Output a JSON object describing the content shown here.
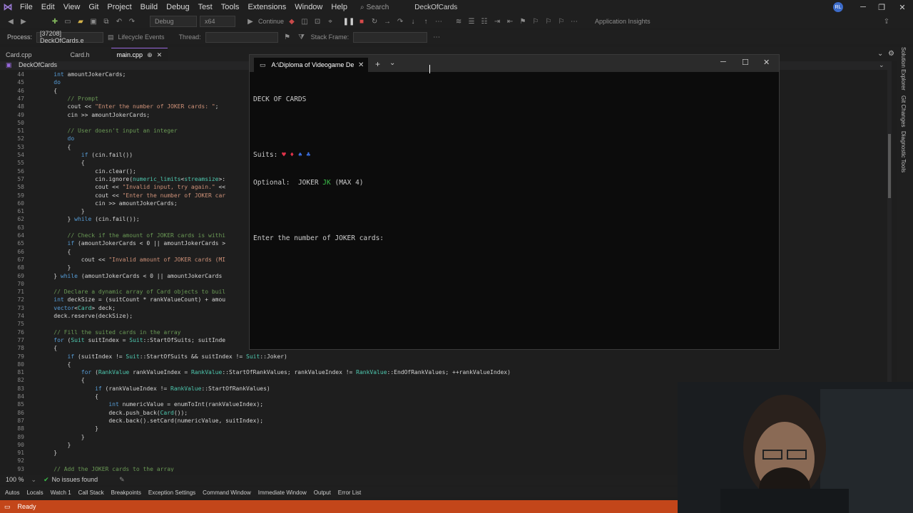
{
  "menu": {
    "items": [
      "File",
      "Edit",
      "View",
      "Git",
      "Project",
      "Build",
      "Debug",
      "Test",
      "Tools",
      "Extensions",
      "Window",
      "Help"
    ],
    "search_label": "Search",
    "solution_name": "DeckOfCards",
    "avatar_initials": "RL"
  },
  "toolbar": {
    "config": "Debug",
    "platform": "x64",
    "continue_label": "Continue",
    "insights_label": "Application Insights"
  },
  "process_bar": {
    "process_label": "Process:",
    "process_value": "[37208] DeckOfCards.e",
    "lifecycle_label": "Lifecycle Events",
    "thread_label": "Thread:",
    "stack_label": "Stack Frame:"
  },
  "doc_tabs": [
    {
      "label": "Card.cpp",
      "active": false
    },
    {
      "label": "Card.h",
      "active": false
    },
    {
      "label": "main.cpp",
      "active": true
    }
  ],
  "editor": {
    "project_scope": "DeckOfCards",
    "lines": [
      {
        "n": "44",
        "t": "    int amountJokerCards;"
      },
      {
        "n": "45",
        "t": "    do"
      },
      {
        "n": "46",
        "t": "    {"
      },
      {
        "n": "47",
        "t": "        // Prompt"
      },
      {
        "n": "48",
        "t": "        cout << \"Enter the number of JOKER cards: \";"
      },
      {
        "n": "49",
        "t": "        cin >> amountJokerCards;"
      },
      {
        "n": "50",
        "t": ""
      },
      {
        "n": "51",
        "t": "        // User doesn't input an integer"
      },
      {
        "n": "52",
        "t": "        do"
      },
      {
        "n": "53",
        "t": "        {"
      },
      {
        "n": "54",
        "t": "            if (cin.fail())"
      },
      {
        "n": "55",
        "t": "            {"
      },
      {
        "n": "56",
        "t": "                cin.clear();"
      },
      {
        "n": "57",
        "t": "                cin.ignore(numeric_limits<streamsize>:"
      },
      {
        "n": "58",
        "t": "                cout << \"Invalid input, try again.\" <<"
      },
      {
        "n": "59",
        "t": "                cout << \"Enter the number of JOKER car"
      },
      {
        "n": "60",
        "t": "                cin >> amountJokerCards;"
      },
      {
        "n": "61",
        "t": "            }"
      },
      {
        "n": "62",
        "t": "        } while (cin.fail());"
      },
      {
        "n": "63",
        "t": ""
      },
      {
        "n": "64",
        "t": "        // Check if the amount of JOKER cards is withi"
      },
      {
        "n": "65",
        "t": "        if (amountJokerCards < 0 || amountJokerCards >"
      },
      {
        "n": "66",
        "t": "        {"
      },
      {
        "n": "67",
        "t": "            cout << \"Invalid amount of JOKER cards (MI"
      },
      {
        "n": "68",
        "t": "        }"
      },
      {
        "n": "69",
        "t": "    } while (amountJokerCards < 0 || amountJokerCards"
      },
      {
        "n": "70",
        "t": ""
      },
      {
        "n": "71",
        "t": "    // Declare a dynamic array of Card objects to buil"
      },
      {
        "n": "72",
        "t": "    int deckSize = (suitCount * rankValueCount) + amou"
      },
      {
        "n": "73",
        "t": "    vector<Card> deck;"
      },
      {
        "n": "74",
        "t": "    deck.reserve(deckSize);"
      },
      {
        "n": "75",
        "t": ""
      },
      {
        "n": "76",
        "t": "    // Fill the suited cards in the array"
      },
      {
        "n": "77",
        "t": "    for (Suit suitIndex = Suit::StartOfSuits; suitInde"
      },
      {
        "n": "78",
        "t": "    {"
      },
      {
        "n": "79",
        "t": "        if (suitIndex != Suit::StartOfSuits && suitIndex != Suit::Joker)"
      },
      {
        "n": "80",
        "t": "        {"
      },
      {
        "n": "81",
        "t": "            for (RankValue rankValueIndex = RankValue::StartOfRankValues; rankValueIndex != RankValue::EndOfRankValues; ++rankValueIndex)"
      },
      {
        "n": "82",
        "t": "            {"
      },
      {
        "n": "83",
        "t": "                if (rankValueIndex != RankValue::StartOfRankValues)"
      },
      {
        "n": "84",
        "t": "                {"
      },
      {
        "n": "85",
        "t": "                    int numericValue = enumToInt(rankValueIndex);"
      },
      {
        "n": "86",
        "t": "                    deck.push_back(Card());"
      },
      {
        "n": "87",
        "t": "                    deck.back().setCard(numericValue, suitIndex);"
      },
      {
        "n": "88",
        "t": "                }"
      },
      {
        "n": "89",
        "t": "            }"
      },
      {
        "n": "90",
        "t": "        }"
      },
      {
        "n": "91",
        "t": "    }"
      },
      {
        "n": "92",
        "t": ""
      },
      {
        "n": "93",
        "t": "    // Add the JOKER cards to the array"
      }
    ]
  },
  "editor_status": {
    "zoom": "100 %",
    "issues": "No issues found"
  },
  "bottom_tabs": [
    "Autos",
    "Locals",
    "Watch 1",
    "Call Stack",
    "Breakpoints",
    "Exception Settings",
    "Command Window",
    "Immediate Window",
    "Output",
    "Error List"
  ],
  "status": {
    "text": "Ready"
  },
  "side_tabs": [
    "Solution Explorer",
    "Git Changes",
    "Diagnostic Tools"
  ],
  "console": {
    "tab_title": "A:\\Diploma of Videogame De",
    "heading": "DECK OF CARDS",
    "suits_label": "Suits:",
    "suit_symbols": [
      "♥",
      "♦",
      "♠",
      "♣"
    ],
    "optional_label": "Optional:",
    "joker_word": "JOKER",
    "joker_code": "JK",
    "max_note": "(MAX 4)",
    "prompt": "Enter the number of JOKER cards:"
  },
  "colors": {
    "accent": "#9a6ae0",
    "status_bar": "#c3461a",
    "suit_red": "#e0334a",
    "suit_blue": "#3b6fe0",
    "joker_green": "#3cc14b",
    "keyword": "#569cd6",
    "string": "#ce9178",
    "comment": "#6a9955"
  }
}
